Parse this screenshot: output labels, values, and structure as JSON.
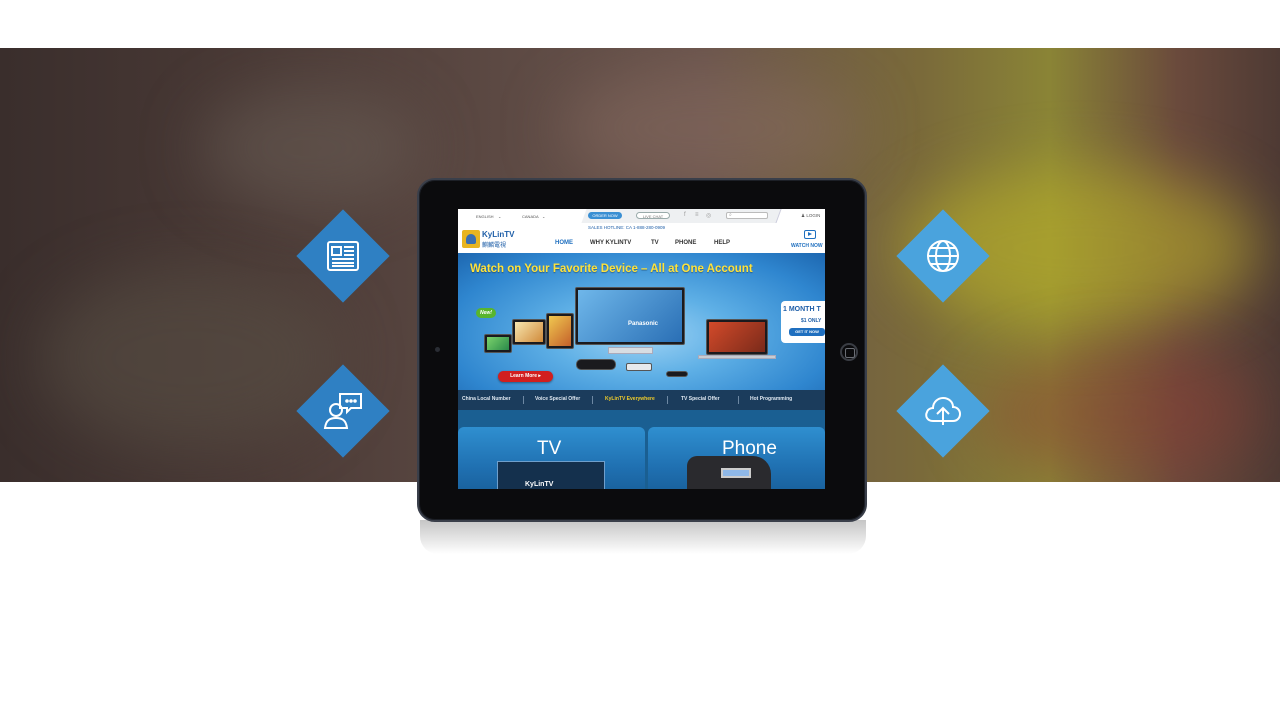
{
  "colors": {
    "diamond_dark": "#2f80c3",
    "diamond_light": "#4aa3dd",
    "brand_blue": "#1f5fa8",
    "hero_title_yellow": "#ffe23a",
    "subnav_bg": "#1b3c5c",
    "subnav_active": "#f1cd2a"
  },
  "features": {
    "news": {
      "icon": "newspaper-icon"
    },
    "web": {
      "icon": "globe-icon"
    },
    "support": {
      "icon": "chat-agent-icon"
    },
    "cloud": {
      "icon": "cloud-upload-icon"
    }
  },
  "website": {
    "top_bar": {
      "language": "ENGLISH",
      "region": "CANADA",
      "order_now": "ORDER NOW",
      "live_chat": "LIVE CHAT",
      "login": "LOGIN",
      "social_icons": [
        "facebook-icon",
        "renren-icon",
        "weibo-icon"
      ]
    },
    "header": {
      "logo_text": "KyLinTV",
      "logo_chinese": "麒麟電視",
      "hotline": "SALES HOTLINE:   CA 1-888-280-0909",
      "nav": [
        "HOME",
        "WHY KYLINTV",
        "TV",
        "PHONE",
        "HELP"
      ],
      "watch_now": "WATCH NOW"
    },
    "hero": {
      "title": "Watch on Your Favorite Device – All at One Account",
      "new_badge": "New!",
      "tv_brand": "Panasonic",
      "learn_more": "Learn More",
      "promo_title": "1 MONTH T",
      "promo_price": "$1 ONLY",
      "promo_cta": "GET IT NOW"
    },
    "subnav": [
      "China Local Number",
      "Voice Special Offer",
      "KyLinTV Everywhere",
      "TV Special Offer",
      "Hot Programming"
    ],
    "subnav_active_index": 2,
    "tiles": {
      "tv": "TV",
      "phone": "Phone",
      "tv_thumb_brand": "KyLinTV"
    }
  }
}
